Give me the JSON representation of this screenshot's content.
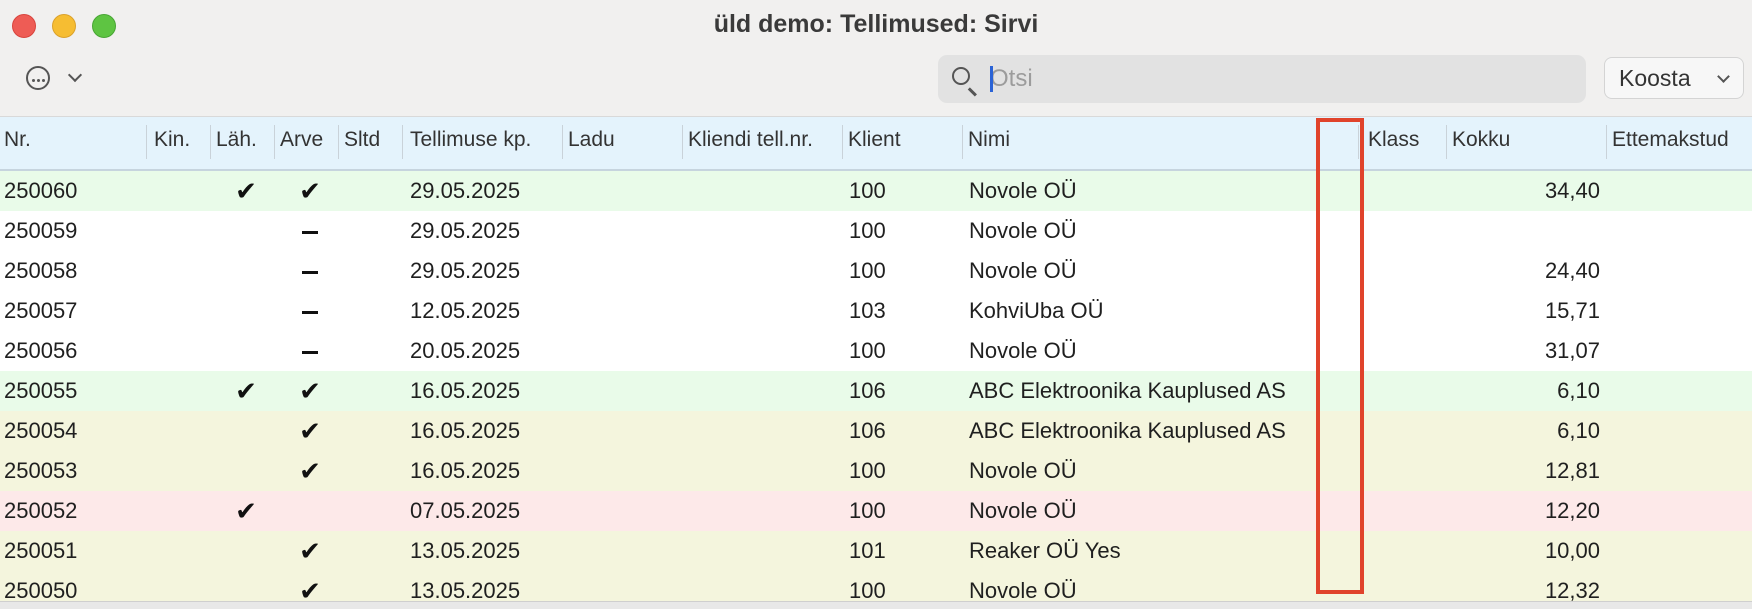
{
  "window": {
    "title": "üld demo: Tellimused: Sirvi"
  },
  "toolbar": {
    "more_icon": "ellipsis-circle-icon",
    "search": {
      "placeholder": "Otsi",
      "value": ""
    },
    "koosta_label": "Koosta"
  },
  "columns": [
    {
      "key": "nr",
      "label": "Nr."
    },
    {
      "key": "kin",
      "label": "Kin."
    },
    {
      "key": "lah",
      "label": "Läh."
    },
    {
      "key": "arve",
      "label": "Arve"
    },
    {
      "key": "sltd",
      "label": "Sltd"
    },
    {
      "key": "tellimuse_kp",
      "label": "Tellimuse kp."
    },
    {
      "key": "ladu",
      "label": "Ladu"
    },
    {
      "key": "kliendi_tell_nr",
      "label": "Kliendi tell.nr."
    },
    {
      "key": "klient",
      "label": "Klient"
    },
    {
      "key": "nimi",
      "label": "Nimi"
    },
    {
      "key": "blank",
      "label": ""
    },
    {
      "key": "klass",
      "label": "Klass"
    },
    {
      "key": "kokku",
      "label": "Kokku"
    },
    {
      "key": "ettemakstud",
      "label": "Ettemakstud"
    }
  ],
  "rows": [
    {
      "nr": "250060",
      "lah": "check",
      "arve": "check",
      "date": "29.05.2025",
      "klient": "100",
      "nimi": "Novole OÜ",
      "kokku": "34,40",
      "color": "green"
    },
    {
      "nr": "250059",
      "lah": "",
      "arve": "dash",
      "date": "29.05.2025",
      "klient": "100",
      "nimi": "Novole OÜ",
      "kokku": "",
      "color": "white"
    },
    {
      "nr": "250058",
      "lah": "",
      "arve": "dash",
      "date": "29.05.2025",
      "klient": "100",
      "nimi": "Novole OÜ",
      "kokku": "24,40",
      "color": "white"
    },
    {
      "nr": "250057",
      "lah": "",
      "arve": "dash",
      "date": "12.05.2025",
      "klient": "103",
      "nimi": "KohviUba OÜ",
      "kokku": "15,71",
      "color": "white"
    },
    {
      "nr": "250056",
      "lah": "",
      "arve": "dash",
      "date": "20.05.2025",
      "klient": "100",
      "nimi": "Novole OÜ",
      "kokku": "31,07",
      "color": "white"
    },
    {
      "nr": "250055",
      "lah": "check",
      "arve": "check",
      "date": "16.05.2025",
      "klient": "106",
      "nimi": "ABC Elektroonika Kauplused AS",
      "kokku": "6,10",
      "color": "green"
    },
    {
      "nr": "250054",
      "lah": "",
      "arve": "check",
      "date": "16.05.2025",
      "klient": "106",
      "nimi": "ABC Elektroonika Kauplused AS",
      "kokku": "6,10",
      "color": "yellow"
    },
    {
      "nr": "250053",
      "lah": "",
      "arve": "check",
      "date": "16.05.2025",
      "klient": "100",
      "nimi": "Novole OÜ",
      "kokku": "12,81",
      "color": "yellow"
    },
    {
      "nr": "250052",
      "lah": "check",
      "arve": "",
      "date": "07.05.2025",
      "klient": "100",
      "nimi": "Novole OÜ",
      "kokku": "12,20",
      "color": "pink"
    },
    {
      "nr": "250051",
      "lah": "",
      "arve": "check",
      "date": "13.05.2025",
      "klient": "101",
      "nimi": "Reaker OÜ Yes",
      "kokku": "10,00",
      "color": "yellow"
    },
    {
      "nr": "250050",
      "lah": "",
      "arve": "check",
      "date": "13.05.2025",
      "klient": "100",
      "nimi": "Novole OÜ",
      "kokku": "12,32",
      "color": "yellow"
    }
  ],
  "symbols": {
    "check": "✔"
  }
}
